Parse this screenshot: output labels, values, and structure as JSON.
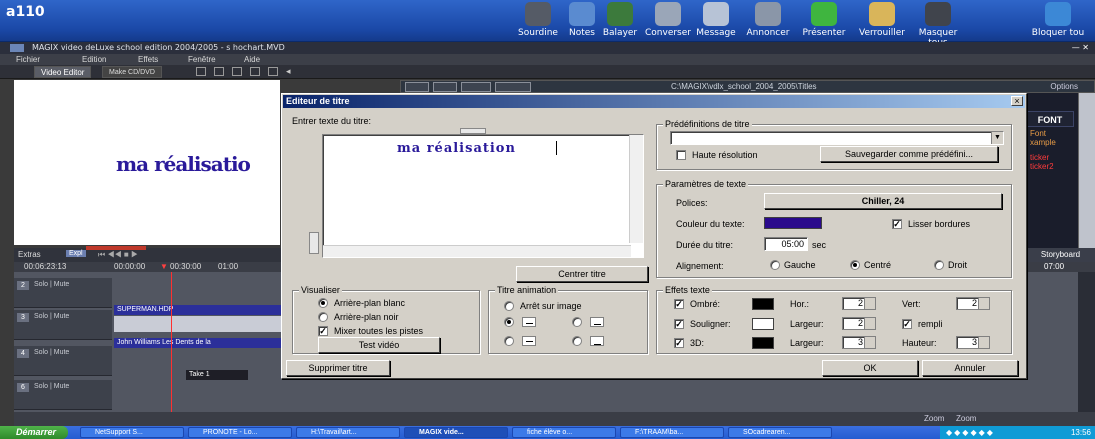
{
  "netsupport": {
    "brand": "a110",
    "buttons": [
      {
        "label": "Sourdine",
        "icon": "speaker-mute-icon",
        "color": "#555b66"
      },
      {
        "label": "Notes",
        "icon": "notes-icon",
        "color": "#5a8bd0"
      },
      {
        "label": "Balayer",
        "icon": "scan-icon",
        "color": "#3c7a3c"
      },
      {
        "label": "Converser",
        "icon": "chat-icon",
        "color": "#9aa6b8"
      },
      {
        "label": "Message",
        "icon": "message-icon",
        "color": "#b7c3d6"
      },
      {
        "label": "Annoncer",
        "icon": "announce-icon",
        "color": "#8a96a8"
      },
      {
        "label": "Présenter",
        "icon": "present-icon",
        "color": "#3fb53f"
      },
      {
        "label": "Verrouiller",
        "icon": "lock-icon",
        "color": "#d9b55a"
      },
      {
        "label": "Masquer tous",
        "icon": "monitor-icon",
        "color": "#40444c"
      },
      {
        "label": "Bloquer tou",
        "icon": "globe-icon",
        "color": "#3c88d6"
      }
    ]
  },
  "magix": {
    "title": "MAGIX video deLuxe school edition 2004/2005 - s hochart.MVD",
    "menu": [
      "Fichier",
      "Edition",
      "Effets",
      "Fenêtre",
      "Aide"
    ],
    "tabs": [
      "Video Editor",
      "Make CD/DVD"
    ],
    "path": "C:\\MAGIX\\vdlx_school_2004_2005\\Titles",
    "options": "Options",
    "preview_text": "ma réalisatio",
    "browser": {
      "font_label": "FONT",
      "line1": "Font",
      "line2": "xample",
      "line3": "ticker",
      "line4": "ticker2"
    },
    "extras": "Extras",
    "expl": "Expl",
    "storyboard": "Storyboard",
    "ruler": [
      "00:06:23:13",
      "00:00:00",
      "00:30:00",
      "01:00",
      "07:00"
    ],
    "tracks": [
      {
        "num": "2",
        "solo": "Solo",
        "mute": "Mute"
      },
      {
        "num": "3",
        "solo": "Solo",
        "mute": "Mute"
      },
      {
        "num": "4",
        "solo": "Solo",
        "mute": "Mute"
      },
      {
        "num": "6",
        "solo": "Solo",
        "mute": "Mute"
      }
    ],
    "clips": [
      "SUPERMAN.HDP",
      "John Williams Les Dents de la",
      "Take 1"
    ],
    "zoom": [
      "Zoom",
      "Zoom"
    ]
  },
  "dialog": {
    "title": "Editeur de titre",
    "close": "×",
    "text_label": "Entrer texte du titre:",
    "text_value": "ma réalisation",
    "center_button": "Centrer titre",
    "presets": {
      "group": "Prédéfinitions de titre",
      "selected": "",
      "hires": "Haute résolution",
      "save_button": "Sauvegarder comme prédéfini..."
    },
    "textparams": {
      "group": "Paramètres de texte",
      "font_label": "Polices:",
      "font_value": "Chiller, 24",
      "color_label": "Couleur du texte:",
      "color_value": "#2a0a8c",
      "smooth": "Lisser bordures",
      "duration_label": "Durée du titre:",
      "duration_value": "05:00",
      "duration_unit": "sec",
      "align_label": "Alignement:",
      "align_options": [
        "Gauche",
        "Centré",
        "Droit"
      ]
    },
    "visualiser": {
      "group": "Visualiser",
      "opt_white": "Arrière-plan blanc",
      "opt_black": "Arrière-plan noir",
      "mix": "Mixer toutes les pistes",
      "test_button": "Test vidéo"
    },
    "animation": {
      "group": "Titre animation",
      "stop": "Arrêt sur image"
    },
    "effects": {
      "group": "Effets texte",
      "shadow": "Ombré:",
      "underline": "Souligner:",
      "d3": "3D:",
      "hor": "Hor.:",
      "vert": "Vert:",
      "width": "Largeur:",
      "height": "Hauteur:",
      "filled": "rempli",
      "v_hor": "2",
      "v_vert": "2",
      "v_w1": "2",
      "v_w2": "3",
      "v_h": "3"
    },
    "delete_button": "Supprimer titre",
    "ok_button": "OK",
    "cancel_button": "Annuler"
  },
  "taskbar": {
    "start": "Démarrer",
    "tasks": [
      "NetSupport S...",
      "PRONOTE - Lo...",
      "H:\\Travail\\art...",
      "MAGIX vide...",
      "fiche élève o...",
      "F:\\TRAAM\\ba...",
      "SOcadrearen..."
    ],
    "clock": "13:56"
  }
}
